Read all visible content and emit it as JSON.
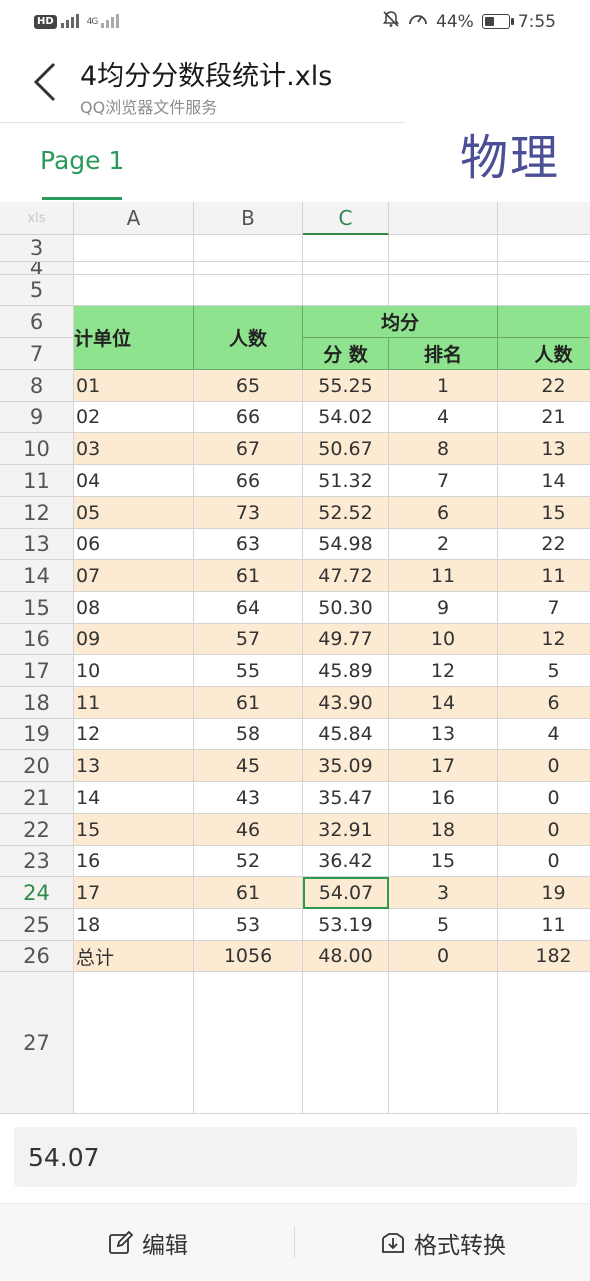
{
  "status_bar": {
    "left_badge": "HD",
    "network": "4G",
    "battery": "44%",
    "battery_level": 0.44,
    "time": "7:55",
    "icons": [
      "mute-icon",
      "speed-icon",
      "battery-icon"
    ]
  },
  "header": {
    "title": "4均分分数段统计.xls",
    "subtitle": "QQ浏览器文件服务"
  },
  "tab": {
    "label": "Page 1"
  },
  "overlay_text": "物理",
  "sheet": {
    "corner": "xls",
    "columns": [
      "A",
      "B",
      "C",
      "",
      ""
    ],
    "selected_column": "C",
    "header_row_labels": {
      "a": "计单位",
      "b": "人数",
      "cd_group": "均分",
      "c": "分 数",
      "d": "排名",
      "e": "人数"
    },
    "top_rows": [
      "3",
      "4",
      "5",
      "6",
      "7"
    ],
    "rows": [
      {
        "num": "8",
        "a": "01",
        "b": "65",
        "c": "55.25",
        "d": "1",
        "e": "22"
      },
      {
        "num": "9",
        "a": "02",
        "b": "66",
        "c": "54.02",
        "d": "4",
        "e": "21"
      },
      {
        "num": "10",
        "a": "03",
        "b": "67",
        "c": "50.67",
        "d": "8",
        "e": "13"
      },
      {
        "num": "11",
        "a": "04",
        "b": "66",
        "c": "51.32",
        "d": "7",
        "e": "14"
      },
      {
        "num": "12",
        "a": "05",
        "b": "73",
        "c": "52.52",
        "d": "6",
        "e": "15"
      },
      {
        "num": "13",
        "a": "06",
        "b": "63",
        "c": "54.98",
        "d": "2",
        "e": "22"
      },
      {
        "num": "14",
        "a": "07",
        "b": "61",
        "c": "47.72",
        "d": "11",
        "e": "11"
      },
      {
        "num": "15",
        "a": "08",
        "b": "64",
        "c": "50.30",
        "d": "9",
        "e": "7"
      },
      {
        "num": "16",
        "a": "09",
        "b": "57",
        "c": "49.77",
        "d": "10",
        "e": "12"
      },
      {
        "num": "17",
        "a": "10",
        "b": "55",
        "c": "45.89",
        "d": "12",
        "e": "5"
      },
      {
        "num": "18",
        "a": "11",
        "b": "61",
        "c": "43.90",
        "d": "14",
        "e": "6"
      },
      {
        "num": "19",
        "a": "12",
        "b": "58",
        "c": "45.84",
        "d": "13",
        "e": "4"
      },
      {
        "num": "20",
        "a": "13",
        "b": "45",
        "c": "35.09",
        "d": "17",
        "e": "0"
      },
      {
        "num": "21",
        "a": "14",
        "b": "43",
        "c": "35.47",
        "d": "16",
        "e": "0"
      },
      {
        "num": "22",
        "a": "15",
        "b": "46",
        "c": "32.91",
        "d": "18",
        "e": "0"
      },
      {
        "num": "23",
        "a": "16",
        "b": "52",
        "c": "36.42",
        "d": "15",
        "e": "0"
      },
      {
        "num": "24",
        "a": "17",
        "b": "61",
        "c": "54.07",
        "d": "3",
        "e": "19"
      },
      {
        "num": "25",
        "a": "18",
        "b": "53",
        "c": "53.19",
        "d": "5",
        "e": "11"
      },
      {
        "num": "26",
        "a": "总计",
        "b": "1056",
        "c": "48.00",
        "d": "0",
        "e": "182"
      }
    ],
    "last_row": "27",
    "selected_row": "24",
    "selected_cell_value": "54.07"
  },
  "formula_bar": {
    "value": "54.07"
  },
  "bottom_bar": {
    "edit_label": "编辑",
    "convert_label": "格式转换"
  },
  "colors": {
    "accent": "#2a9a5a",
    "header_green": "#8fe38f",
    "row_peach": "#fcebd2",
    "overlay": "#4a4f96"
  }
}
